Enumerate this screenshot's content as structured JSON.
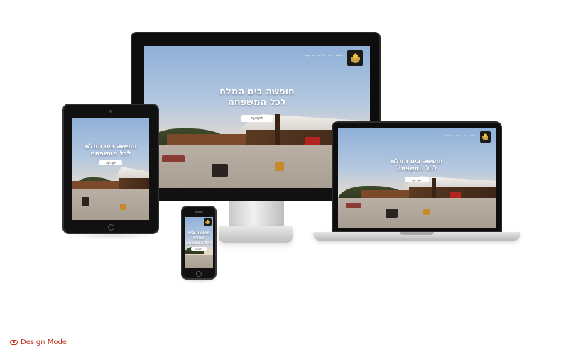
{
  "site": {
    "nav_items": [
      "אודות",
      "לינה",
      "גלריה",
      "צור קשר"
    ],
    "hero_line1": "חופשה בים המלח",
    "hero_line2": "לכל המשפחה",
    "hero_button": "לקביעה"
  },
  "footer": {
    "design_mode_label": "Design Mode",
    "design_mode_icon": "eye-icon"
  },
  "colors": {
    "accent": "#c1321c",
    "device_frame": "#0d0d0d",
    "background": "#ffffff"
  }
}
